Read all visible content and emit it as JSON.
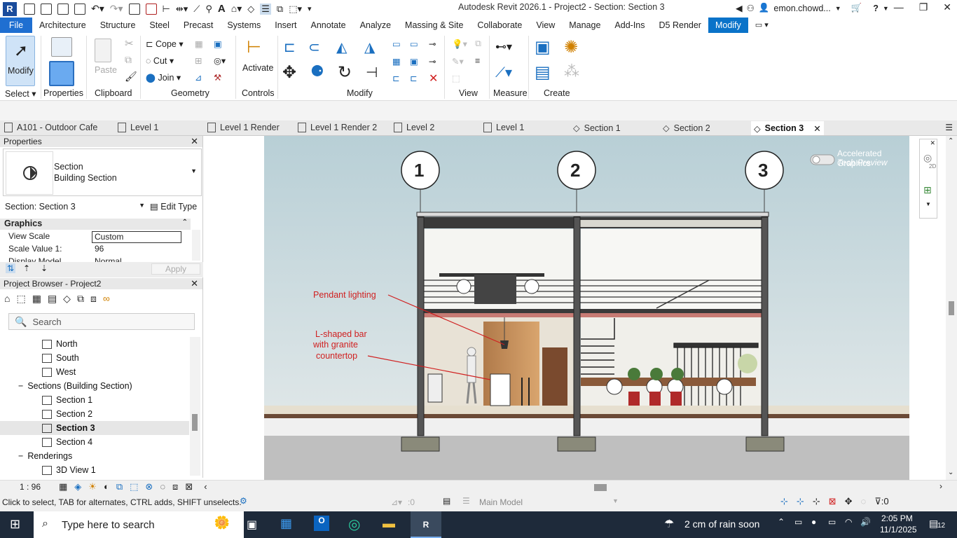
{
  "app": {
    "title": "Autodesk Revit 2026.1 - Project2 - Section: Section 3",
    "user": "emon.chowd...",
    "logo_letter": "R"
  },
  "ribbon_tabs": [
    "File",
    "Architecture",
    "Structure",
    "Steel",
    "Precast",
    "Systems",
    "Insert",
    "Annotate",
    "Analyze",
    "Massing & Site",
    "Collaborate",
    "View",
    "Manage",
    "Add-Ins",
    "D5 Render",
    "Modify"
  ],
  "ribbon": {
    "modify_label": "Modify",
    "properties_label": "Properties",
    "paste_label": "Paste",
    "cope_label": "Cope",
    "cut_label": "Cut",
    "join_label": "Join",
    "activate_label": "Activate",
    "panels": {
      "select": "Select",
      "properties": "Properties",
      "clipboard": "Clipboard",
      "geometry": "Geometry",
      "controls": "Controls",
      "modify": "Modify",
      "view": "View",
      "measure": "Measure",
      "create": "Create"
    }
  },
  "view_tabs": [
    {
      "label": "A101 - Outdoor Cafe",
      "active": false
    },
    {
      "label": "Level 1",
      "active": false
    },
    {
      "label": "Level 1 Render",
      "active": false
    },
    {
      "label": "Level 1 Render 2",
      "active": false
    },
    {
      "label": "Level 2",
      "active": false
    },
    {
      "label": "Level 1",
      "active": false
    },
    {
      "label": "Section 1",
      "active": false
    },
    {
      "label": "Section 2",
      "active": false
    },
    {
      "label": "Section 3",
      "active": true
    }
  ],
  "properties": {
    "header": "Properties",
    "type_line1": "Section",
    "type_line2": "Building Section",
    "instance_selector": "Section: Section 3",
    "edit_type": "Edit Type",
    "group": "Graphics",
    "rows": [
      {
        "name": "View Scale",
        "value": "Custom"
      },
      {
        "name": "Scale Value   1:",
        "value": "96"
      },
      {
        "name": "Display Model",
        "value": "Normal"
      }
    ],
    "apply": "Apply"
  },
  "browser": {
    "header": "Project Browser - Project2",
    "search_placeholder": "Search",
    "items": [
      {
        "label": "North",
        "level": 2
      },
      {
        "label": "South",
        "level": 2
      },
      {
        "label": "West",
        "level": 2
      },
      {
        "label": "Sections (Building Section)",
        "level": 1
      },
      {
        "label": "Section 1",
        "level": 2
      },
      {
        "label": "Section 2",
        "level": 2
      },
      {
        "label": "Section 3",
        "level": 2,
        "selected": true
      },
      {
        "label": "Section 4",
        "level": 2
      },
      {
        "label": "Renderings",
        "level": 1
      },
      {
        "label": "3D View 1",
        "level": 2
      }
    ]
  },
  "drawing": {
    "grid_labels": [
      "1",
      "2",
      "3"
    ],
    "annotation_pendant": "Pendant lighting",
    "annotation_bar_1": "L-shaped bar",
    "annotation_bar_2": "with granite",
    "annotation_bar_3": "countertop",
    "accel_1": "Accelerated Graphics",
    "accel_2": "Tech Preview",
    "nav_2d": "2D"
  },
  "viewbar": {
    "scale": "1 : 96"
  },
  "status": {
    "hint": "Click to select, TAB for alternates, CTRL adds, SHIFT unselects.",
    "selection_count": ":0",
    "model": "Main Model",
    "filter_count": ":0"
  },
  "taskbar": {
    "search_placeholder": "Type here to search",
    "weather": "2 cm of rain soon",
    "time": "2:05 PM",
    "date": "11/1/2025",
    "notifications": "12"
  }
}
